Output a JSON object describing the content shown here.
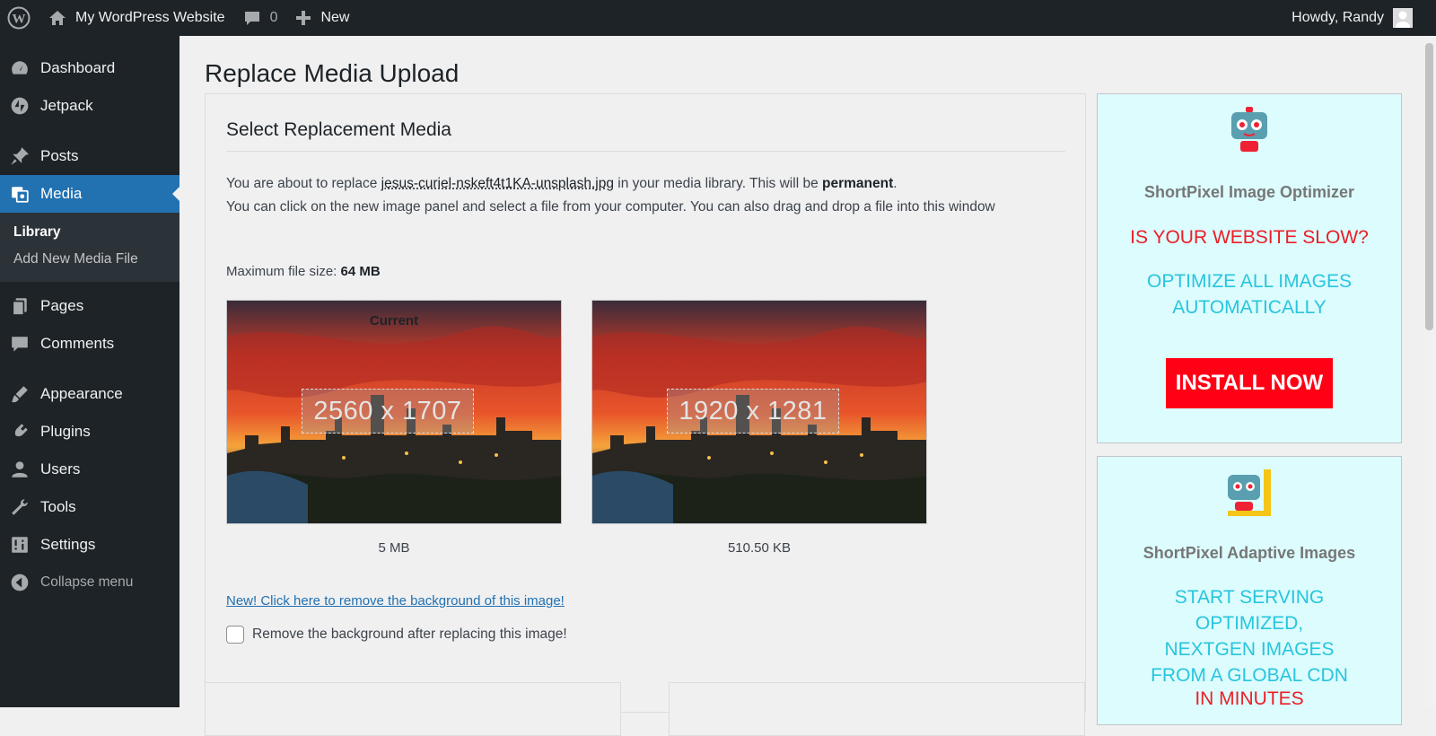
{
  "adminbar": {
    "site_name": "My WordPress Website",
    "comments_count": "0",
    "new_label": "New",
    "howdy": "Howdy, Randy"
  },
  "sidebar": {
    "items": [
      {
        "label": "Dashboard",
        "icon": "dashboard-icon"
      },
      {
        "label": "Jetpack",
        "icon": "jetpack-icon"
      },
      {
        "label": "Posts",
        "icon": "pin-icon"
      },
      {
        "label": "Media",
        "icon": "media-icon"
      },
      {
        "label": "Pages",
        "icon": "pages-icon"
      },
      {
        "label": "Comments",
        "icon": "comment-icon"
      },
      {
        "label": "Appearance",
        "icon": "brush-icon"
      },
      {
        "label": "Plugins",
        "icon": "plugin-icon"
      },
      {
        "label": "Users",
        "icon": "user-icon"
      },
      {
        "label": "Tools",
        "icon": "wrench-icon"
      },
      {
        "label": "Settings",
        "icon": "settings-icon"
      },
      {
        "label": "Collapse menu",
        "icon": "collapse-icon"
      }
    ],
    "media_submenu": [
      "Library",
      "Add New Media File"
    ]
  },
  "page": {
    "title": "Replace Media Upload",
    "section_title": "Select Replacement Media",
    "desc_prefix": "You are about to replace ",
    "filename": "jesus-curiel-nskeft4t1KA-unsplash.jpg",
    "desc_mid": " in your media library. This will be ",
    "permanent": "permanent",
    "desc_suffix": ".",
    "desc_line2": "You can click on the new image panel and select a file from your computer. You can also drag and drop a file into this window",
    "max_size_label": "Maximum file size: ",
    "max_size_value": "64 MB",
    "current_label": "Current",
    "current_dims": "2560 x 1707",
    "current_size": "5 MB",
    "new_dims": "1920 x 1281",
    "new_size": "510.50 KB",
    "bg_link": "New! Click here to remove the background of this image!",
    "bg_checkbox_label": "Remove the background after replacing this image!"
  },
  "ads": {
    "ad1": {
      "title": "ShortPixel Image Optimizer",
      "headline": "IS YOUR WEBSITE SLOW?",
      "line1": "OPTIMIZE ALL IMAGES",
      "line2": "AUTOMATICALLY",
      "button": "INSTALL NOW"
    },
    "ad2": {
      "title": "ShortPixel Adaptive Images",
      "line1": "START SERVING",
      "line2": "OPTIMIZED,",
      "line3": "NEXTGEN IMAGES",
      "line4": "FROM A GLOBAL CDN",
      "line5": "IN MINUTES"
    }
  },
  "colors": {
    "adminbar_bg": "#1d2327",
    "menu_current": "#2271b1",
    "link": "#2271b1",
    "ad_bg": "#dcfcfe",
    "ad_red": "#ec1e26",
    "ad_cyan": "#29c5dd",
    "install_btn": "#ff0014"
  }
}
